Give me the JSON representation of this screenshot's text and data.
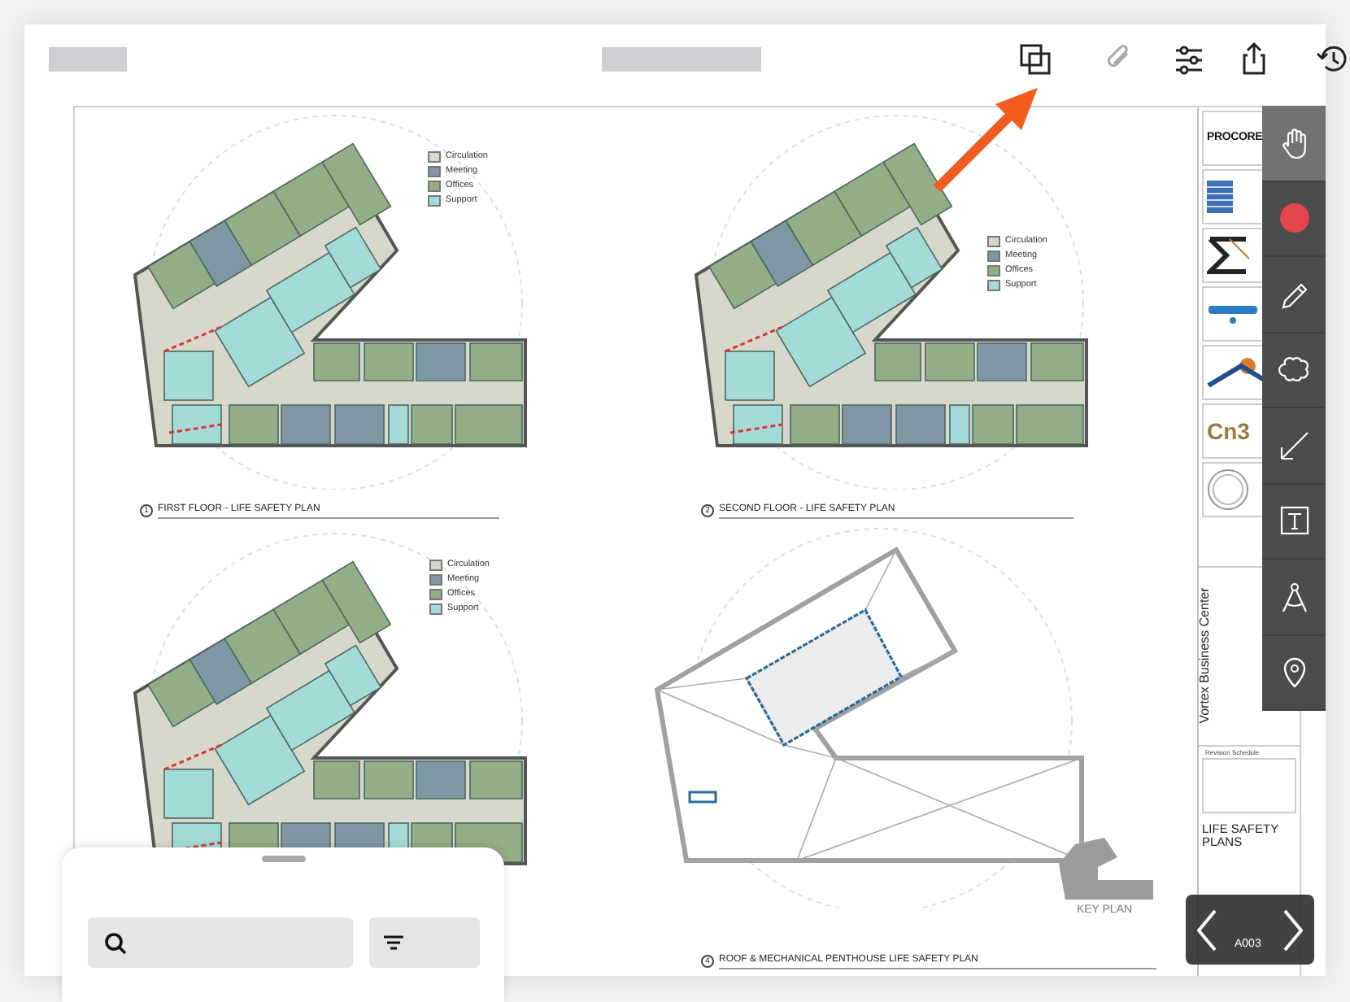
{
  "top_bar": {
    "tools": [
      {
        "kind": "layers",
        "disabled": false
      },
      {
        "kind": "attachment",
        "disabled": true
      },
      {
        "kind": "filters",
        "disabled": false
      },
      {
        "kind": "share",
        "disabled": false
      },
      {
        "kind": "history",
        "disabled": false
      }
    ]
  },
  "sheet": {
    "plans": [
      {
        "kind": "floor",
        "number": "1",
        "title": "FIRST FLOOR - LIFE SAFETY PLAN",
        "legend": [
          {
            "label": "Circulation",
            "color": "#d8d7cb"
          },
          {
            "label": "Meeting",
            "color": "#7f97a5"
          },
          {
            "label": "Offices",
            "color": "#93ad86"
          },
          {
            "label": "Support",
            "color": "#a3dbd8"
          }
        ]
      },
      {
        "kind": "floor",
        "number": "2",
        "title": "SECOND FLOOR - LIFE SAFETY PLAN",
        "legend": [
          {
            "label": "Circulation",
            "color": "#d8d7cb"
          },
          {
            "label": "Meeting",
            "color": "#7f97a5"
          },
          {
            "label": "Offices",
            "color": "#93ad86"
          },
          {
            "label": "Support",
            "color": "#a3dbd8"
          }
        ]
      },
      {
        "kind": "floor",
        "legend": [
          {
            "label": "Circulation",
            "color": "#d8d7cb"
          },
          {
            "label": "Meeting",
            "color": "#7f97a5"
          },
          {
            "label": "Offices",
            "color": "#93ad86"
          },
          {
            "label": "Support",
            "color": "#a3dbd8"
          }
        ]
      },
      {
        "kind": "roof",
        "number": "4",
        "title": "ROOF & MECHANICAL PENTHOUSE LIFE SAFETY PLAN"
      }
    ],
    "key_plan": {
      "label": "KEY PLAN"
    },
    "title_block": {
      "logos": [
        {
          "kind": "text",
          "text": "PROCORE"
        },
        {
          "kind": "building"
        },
        {
          "kind": "sigma"
        },
        {
          "kind": "pipe"
        },
        {
          "kind": "house"
        },
        {
          "kind": "text",
          "text": "Cn3"
        },
        {
          "kind": "seal"
        }
      ],
      "project_name": "Vortex Business Center",
      "revision_heading": "Revision Schedule",
      "sheet_name": "LIFE SAFETY PLANS"
    }
  },
  "markup_tools": [
    {
      "kind": "hand",
      "selected": true
    },
    {
      "kind": "color",
      "selected": false
    },
    {
      "kind": "pencil",
      "selected": false
    },
    {
      "kind": "cloud",
      "selected": false
    },
    {
      "kind": "arrow",
      "selected": false
    },
    {
      "kind": "text",
      "selected": false
    },
    {
      "kind": "measure",
      "selected": false
    },
    {
      "kind": "pin",
      "selected": false
    }
  ],
  "navigator": {
    "sheet_number": "A003"
  }
}
